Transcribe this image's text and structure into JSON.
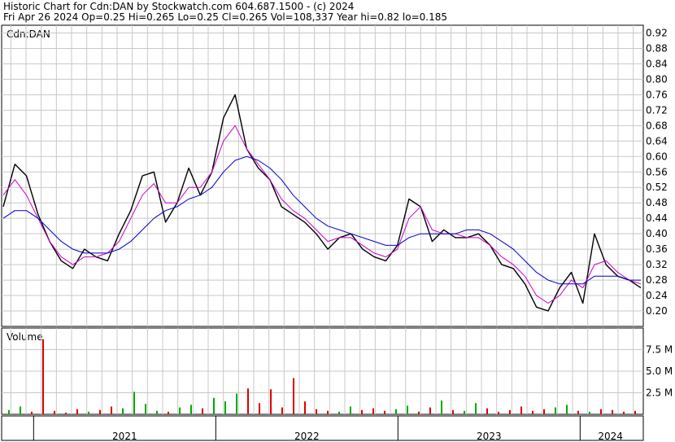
{
  "header": {
    "line1": "Historic Chart for Cdn:DAN by Stockwatch.com 604.687.1500 - (c) 2024",
    "line2": "Fri Apr 26 2024   Op=0.25  Hi=0.265  Lo=0.25  Cl=0.265  Vol=108,337  Year hi=0.82  lo=0.185"
  },
  "chart_data": [
    {
      "type": "line",
      "label": "Cdn:DAN",
      "ylim": [
        0.16,
        0.94
      ],
      "y_ticks": [
        0.92,
        0.88,
        0.84,
        0.8,
        0.76,
        0.72,
        0.68,
        0.64,
        0.6,
        0.56,
        0.52,
        0.48,
        0.44,
        0.4,
        0.36,
        0.32,
        0.28,
        0.24,
        0.2
      ],
      "y_tick_labels": [
        "0.92",
        "0.88",
        "0.84",
        "0.80",
        "0.76",
        "0.72",
        "0.68",
        "0.64",
        "0.60",
        "0.56",
        "0.52",
        "0.48",
        "0.44",
        "0.40",
        "0.36",
        "0.32",
        "0.28",
        "0.24",
        "0.20"
      ],
      "x": [
        "2020-11",
        "2020-12",
        "2021-01",
        "2021-02",
        "2021-03",
        "2021-04",
        "2021-05",
        "2021-06",
        "2021-07",
        "2021-08",
        "2021-09",
        "2021-10",
        "2021-11",
        "2021-12",
        "2022-01",
        "2022-02",
        "2022-03",
        "2022-04",
        "2022-05",
        "2022-06",
        "2022-07",
        "2022-08",
        "2022-09",
        "2022-10",
        "2022-11",
        "2022-12",
        "2023-01",
        "2023-02",
        "2023-03",
        "2023-04",
        "2023-05",
        "2023-06",
        "2023-07",
        "2023-08",
        "2023-09",
        "2023-10",
        "2023-11",
        "2023-12",
        "2024-01",
        "2024-02",
        "2024-03",
        "2024-04"
      ],
      "series": [
        {
          "style": "price",
          "color": "#000000",
          "values": [
            0.47,
            0.58,
            0.55,
            0.45,
            0.38,
            0.33,
            0.31,
            0.36,
            0.34,
            0.33,
            0.4,
            0.46,
            0.55,
            0.56,
            0.43,
            0.48,
            0.57,
            0.5,
            0.56,
            0.7,
            0.76,
            0.62,
            0.57,
            0.54,
            0.47,
            0.45,
            0.43,
            0.4,
            0.36,
            0.39,
            0.4,
            0.36,
            0.34,
            0.33,
            0.37,
            0.49,
            0.47,
            0.38,
            0.41,
            0.39,
            0.39,
            0.4,
            0.37,
            0.32,
            0.31,
            0.27,
            0.21,
            0.2,
            0.26,
            0.3,
            0.22,
            0.4,
            0.32,
            0.29,
            0.28,
            0.26
          ]
        },
        {
          "style": "short-ma",
          "color": "#cc00cc",
          "values": [
            0.5,
            0.54,
            0.5,
            0.44,
            0.38,
            0.34,
            0.32,
            0.34,
            0.34,
            0.35,
            0.38,
            0.44,
            0.5,
            0.53,
            0.48,
            0.48,
            0.52,
            0.52,
            0.56,
            0.64,
            0.68,
            0.62,
            0.58,
            0.54,
            0.49,
            0.46,
            0.44,
            0.41,
            0.38,
            0.39,
            0.39,
            0.37,
            0.35,
            0.34,
            0.36,
            0.44,
            0.47,
            0.41,
            0.4,
            0.4,
            0.39,
            0.39,
            0.37,
            0.34,
            0.32,
            0.29,
            0.24,
            0.22,
            0.24,
            0.28,
            0.26,
            0.32,
            0.33,
            0.3,
            0.28,
            0.27
          ]
        },
        {
          "style": "long-ma",
          "color": "#0000cc",
          "values": [
            0.44,
            0.46,
            0.46,
            0.44,
            0.41,
            0.38,
            0.36,
            0.35,
            0.35,
            0.35,
            0.36,
            0.38,
            0.41,
            0.44,
            0.46,
            0.47,
            0.49,
            0.5,
            0.52,
            0.56,
            0.59,
            0.6,
            0.59,
            0.57,
            0.54,
            0.5,
            0.47,
            0.44,
            0.42,
            0.41,
            0.4,
            0.39,
            0.38,
            0.37,
            0.37,
            0.39,
            0.4,
            0.4,
            0.4,
            0.4,
            0.41,
            0.41,
            0.4,
            0.38,
            0.36,
            0.33,
            0.3,
            0.28,
            0.27,
            0.27,
            0.27,
            0.29,
            0.29,
            0.29,
            0.28,
            0.28
          ]
        }
      ]
    },
    {
      "type": "bar",
      "label": "Volume",
      "ylim": [
        0,
        10000000
      ],
      "y_ticks": [
        7500000,
        5000000,
        2500000
      ],
      "y_tick_labels": [
        "7.5 M",
        "5.0 M",
        "2.5 M"
      ],
      "series": [
        {
          "values": [
            500000,
            900000,
            300000,
            8700000,
            400000,
            200000,
            600000,
            300000,
            500000,
            900000,
            700000,
            2600000,
            1200000,
            400000,
            300000,
            800000,
            1100000,
            700000,
            1900000,
            1500000,
            2400000,
            3000000,
            1300000,
            2900000,
            800000,
            4200000,
            1500000,
            600000,
            400000,
            300000,
            900000,
            500000,
            700000,
            400000,
            600000,
            1000000,
            300000,
            800000,
            1600000,
            500000,
            400000,
            1300000,
            700000,
            300000,
            500000,
            900000,
            400000,
            600000,
            800000,
            1100000,
            400000,
            300000,
            600000,
            500000,
            300000,
            400000
          ]
        }
      ]
    }
  ],
  "x_axis": {
    "years": [
      "2021",
      "2022",
      "2023",
      "2024"
    ]
  },
  "colors": {
    "up_volume": "#00aa00",
    "down_volume": "#dd0000",
    "grid": "#c8c8c8"
  }
}
